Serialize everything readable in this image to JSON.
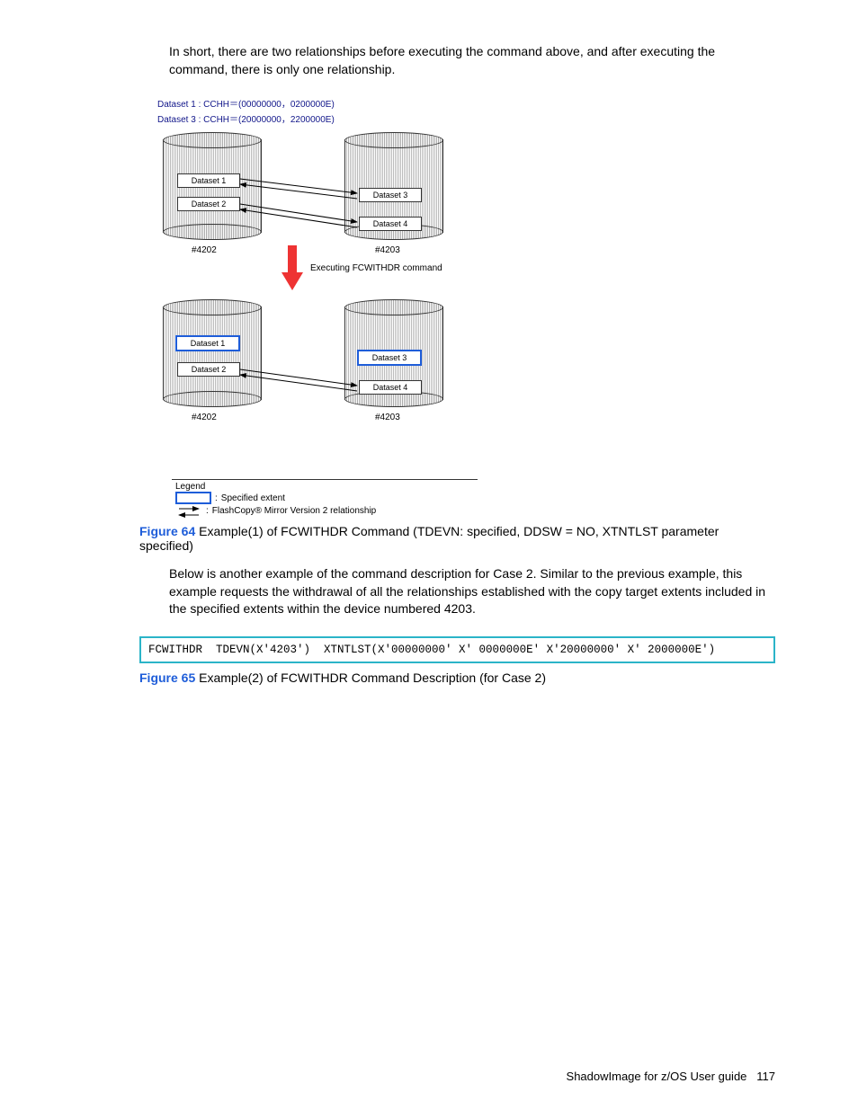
{
  "paragraph1": "In short, there are two relationships before executing the command above, and after executing the command, there is only one relationship.",
  "diagram": {
    "d1": "Dataset 1 : CCHH＝(00000000，0200000E)",
    "d3": "Dataset 3 : CCHH＝(20000000，2200000E)",
    "ds1": "Dataset 1",
    "ds2": "Dataset 2",
    "ds3": "Dataset 3",
    "ds4": "Dataset 4",
    "dev_left": "#4202",
    "dev_right": "#4203",
    "exec": "Executing FCWITHDR command",
    "legend_title": "Legend",
    "legend_extent": "Specified extent",
    "legend_rel": "FlashCopy® Mirror Version 2 relationship"
  },
  "fig64_label": "Figure 64",
  "fig64_text": "  Example(1) of FCWITHDR Command (TDEVN: specified, DDSW = NO, XTNTLST parameter specified)",
  "paragraph2": "Below is another example of the command description for Case 2. Similar to the previous example, this example requests the withdrawal of all the relationships established with the copy target extents included in the specified extents within the device numbered 4203.",
  "code": "FCWITHDR  TDEVN(X'4203')  XTNTLST(X'00000000' X' 0000000E' X'20000000' X' 2000000E')",
  "fig65_label": "Figure 65",
  "fig65_text": "  Example(2) of FCWITHDR Command Description (for Case 2)",
  "footer_text": "ShadowImage for z/OS User guide",
  "footer_page": "117"
}
